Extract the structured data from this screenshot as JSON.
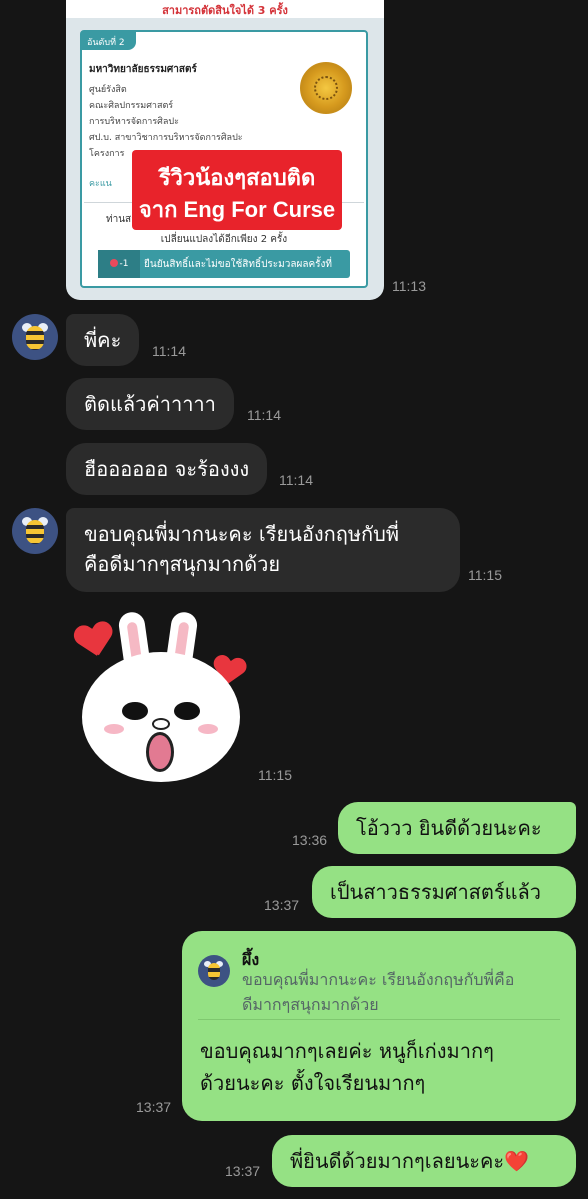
{
  "shared_image": {
    "top_notice": "สามารถตัดสินใจได้ 3 ครั้ง",
    "rank_label": "อันดับที่ 2",
    "university": "มหาวิทยาลัยธรรมศาสตร์",
    "lines": [
      "ศูนย์รังสิต",
      "คณะศิลปกรรมศาสตร์",
      "การบริหารจัดการศิลปะ",
      "ศป.บ. สาขาวิชาการบริหารจัดการศิลปะ",
      "โครงการ",
      "คะแน"
    ],
    "sub_text_1": "ท่านสา",
    "sub_text_2": "เปลี่ยนแปลงได้อีกเพียง 2 ครั้ง",
    "button_count": "-1",
    "button_label": "ยืนยันสิทธิ์และไม่ขอใช้สิทธิ์ประมวลผลครั้งที่",
    "banner_line1": "รีวิวน้องๆสอบติด",
    "banner_line2": "จาก Eng For Curse",
    "time": "11:13"
  },
  "messages_in": [
    {
      "lines": [
        "พี่คะ"
      ],
      "time": "11:14"
    },
    {
      "lines": [
        "ติดแล้วค่าาาาา"
      ],
      "time": "11:14"
    },
    {
      "lines": [
        "ฮืออออออ จะร้องงง"
      ],
      "time": "11:14"
    },
    {
      "lines": [
        "ขอบคุณพี่มากนะคะ เรียนอังกฤษกับพี่",
        "คือดีมากๆสนุกมากด้วย"
      ],
      "time": "11:15"
    }
  ],
  "sticker": {
    "time": "11:15"
  },
  "messages_out": [
    {
      "lines": [
        "โอ้ววว ยินดีด้วยนะคะ"
      ],
      "time": "13:36"
    },
    {
      "lines": [
        "เป็นสาวธรรมศาสตร์แล้ว"
      ],
      "time": "13:37"
    },
    {
      "reply_to_name": "ผึ้ง",
      "reply_to_lines": [
        "ขอบคุณพี่มากนะคะ เรียนอังกฤษกับพี่คือ",
        "ดีมากๆสนุกมากด้วย"
      ],
      "lines": [
        "ขอบคุณมากๆเลยค่ะ หนูก็เก่งมากๆ",
        "ด้วยนะคะ ตั้งใจเรียนมากๆ"
      ],
      "time": "13:37"
    },
    {
      "lines": [
        "พี่ยินดีด้วยมากๆเลยนะคะ❤️"
      ],
      "time": "13:37"
    }
  ],
  "colors": {
    "background": "#151515",
    "incoming_bubble": "#2b2b2b",
    "outgoing_bubble": "#95e184",
    "banner": "#e8232b"
  },
  "icons": {
    "avatar": "bee-avatar-icon",
    "sticker": "bunny-sticker",
    "heart": "heart-icon"
  }
}
